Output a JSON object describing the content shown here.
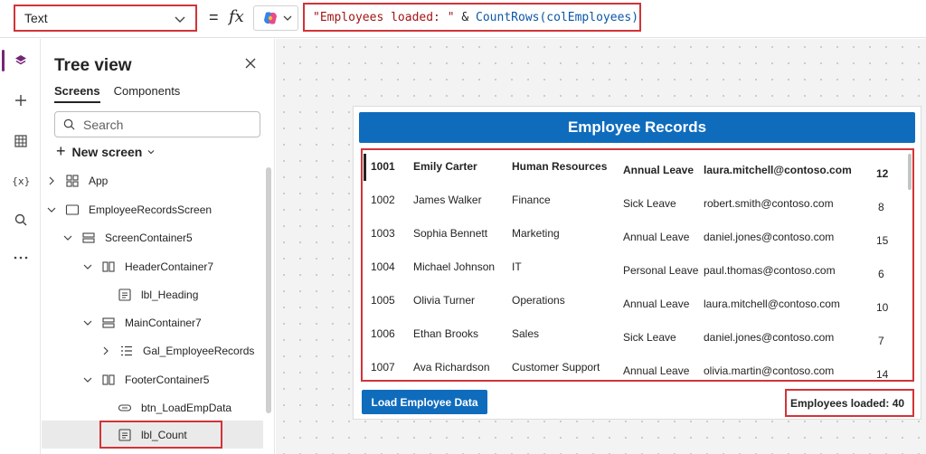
{
  "formula_bar": {
    "property": "Text",
    "equals": "=",
    "fx": "fx",
    "formula_string": "\"Employees loaded: \"",
    "formula_op": " & ",
    "formula_fn": "CountRows(colEmployees)"
  },
  "tree": {
    "title": "Tree view",
    "tabs": [
      "Screens",
      "Components"
    ],
    "search_placeholder": "Search",
    "new_screen": "New screen",
    "nodes": [
      "App",
      "EmployeeRecordsScreen",
      "ScreenContainer5",
      "HeaderContainer7",
      "lbl_Heading",
      "MainContainer7",
      "Gal_EmployeeRecords",
      "FooterContainer5",
      "btn_LoadEmpData",
      "lbl_Count"
    ]
  },
  "app": {
    "header": "Employee Records",
    "rows": [
      [
        "1001",
        "Emily Carter",
        "Human Resources",
        "Annual Leave",
        "laura.mitchell@contoso.com",
        "12"
      ],
      [
        "1002",
        "James Walker",
        "Finance",
        "Sick Leave",
        "robert.smith@contoso.com",
        "8"
      ],
      [
        "1003",
        "Sophia Bennett",
        "Marketing",
        "Annual Leave",
        "daniel.jones@contoso.com",
        "15"
      ],
      [
        "1004",
        "Michael Johnson",
        "IT",
        "Personal Leave",
        "paul.thomas@contoso.com",
        "6"
      ],
      [
        "1005",
        "Olivia Turner",
        "Operations",
        "Annual Leave",
        "laura.mitchell@contoso.com",
        "10"
      ],
      [
        "1006",
        "Ethan Brooks",
        "Sales",
        "Sick Leave",
        "daniel.jones@contoso.com",
        "7"
      ],
      [
        "1007",
        "Ava Richardson",
        "Customer Support",
        "Annual Leave",
        "olivia.martin@contoso.com",
        "14"
      ]
    ],
    "load_button": "Load Employee Data",
    "count_label": "Employees loaded: 40"
  },
  "colors": {
    "accent": "#0f6cbd",
    "highlight": "#d13438",
    "rail_active": "#742774"
  }
}
